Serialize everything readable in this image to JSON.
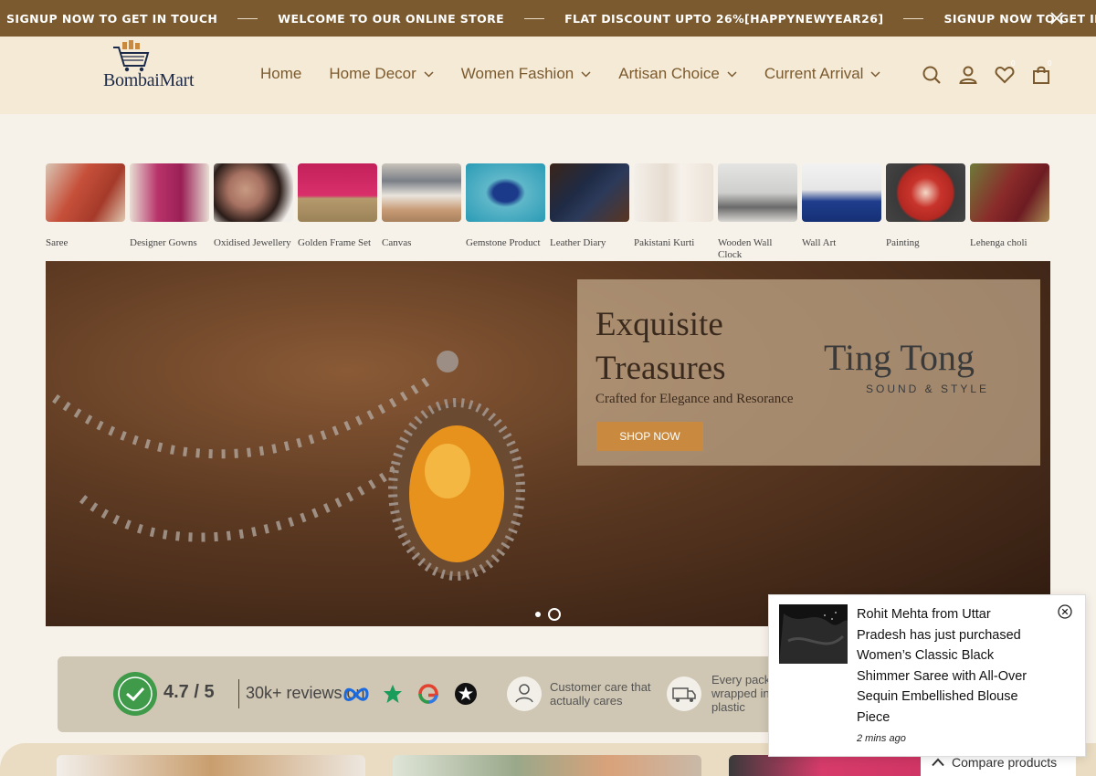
{
  "announcement": {
    "messages": [
      "SIGNUP NOW TO GET IN TOUCH",
      "WELCOME TO OUR ONLINE STORE",
      "FLAT DISCOUNT UPTO 26%[HAPPYNEWYEAR26]",
      "SIGNUP NOW TO GET IN TOUCH"
    ],
    "close_icon": "close-icon"
  },
  "header": {
    "logo_text": "BombaiMart",
    "nav": [
      {
        "label": "Home",
        "has_dropdown": false
      },
      {
        "label": "Home Decor",
        "has_dropdown": true
      },
      {
        "label": "Women Fashion",
        "has_dropdown": true
      },
      {
        "label": "Artisan Choice",
        "has_dropdown": true
      },
      {
        "label": "Current Arrival",
        "has_dropdown": true
      }
    ],
    "icons": [
      "search-icon",
      "account-icon",
      "wishlist-icon",
      "cart-icon"
    ],
    "wishlist_count": "0",
    "cart_count": "0"
  },
  "categories": [
    {
      "label": "Saree"
    },
    {
      "label": "Designer Gowns"
    },
    {
      "label": "Oxidised Jewellery"
    },
    {
      "label": "Golden Frame Set"
    },
    {
      "label": "Canvas"
    },
    {
      "label": "Gemstone Product"
    },
    {
      "label": "Leather Diary"
    },
    {
      "label": "Pakistani Kurti"
    },
    {
      "label": "Wooden Wall Clock"
    },
    {
      "label": "Wall Art"
    },
    {
      "label": "Painting"
    },
    {
      "label": "Lehenga choli"
    }
  ],
  "hero": {
    "heading_line1": "Exquisite",
    "heading_line2": "Treasures",
    "subheading": "Crafted for Elegance and Resorance",
    "button": "SHOP NOW",
    "brand": "Ting Tong",
    "brand_tagline": "SOUND & STYLE"
  },
  "trust": {
    "rating": "4.7 / 5",
    "reviews": "30k+ reviews on",
    "care_line1": "Customer care that",
    "care_line2": "actually cares",
    "pack_line1": "Every packa",
    "pack_line2": "wrapped in",
    "pack_line3": "plastic"
  },
  "popup": {
    "message": "Rohit Mehta from Uttar Pradesh has just purchased Women’s Classic Black Shimmer Saree with All-Over Sequin Embellished Blouse Piece",
    "time": "2 mins ago"
  },
  "compare": {
    "label": "Compare products"
  },
  "colors": {
    "announce_bg": "#7a5a2e",
    "header_bg": "#f5ead6",
    "page_bg": "#f7f2e9",
    "nav_text": "#7a5a2e",
    "accent": "#c98a3f"
  }
}
